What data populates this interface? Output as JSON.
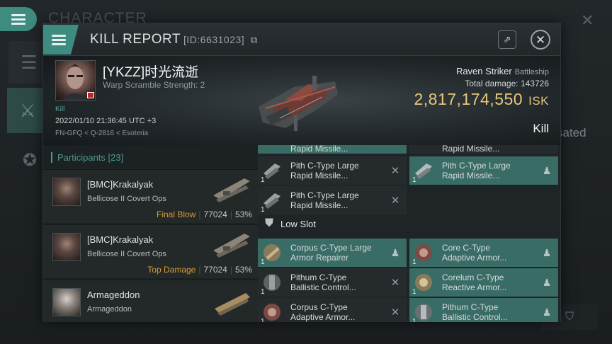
{
  "background_window": {
    "title": "CHARACTER",
    "side_text": "sated"
  },
  "header": {
    "title": "KILL REPORT",
    "id_label": "[ID:6631023]"
  },
  "victim": {
    "name": "[YKZZ]时光流逝",
    "warp_scramble": "Warp Scramble Strength: 2",
    "kill_tag": "Kill",
    "date": "2022/01/10 21:36:45 UTC +3",
    "location": "FN-GFQ < Q-2816 < Esoteria",
    "ship_name": "Raven Striker",
    "ship_class": "Battleship",
    "total_damage_label": "Total damage:",
    "total_damage": "143726",
    "isk_value": "2,817,174,550",
    "isk_unit": "ISK",
    "result": "Kill"
  },
  "participants": {
    "header": "Participants [23]",
    "items": [
      {
        "name": "[BMC]Krakalyak",
        "ship": "Bellicose II Covert Ops",
        "role": "Final Blow",
        "damage": "77024",
        "percent": "53%"
      },
      {
        "name": "[BMC]Krakalyak",
        "ship": "Bellicose II Covert Ops",
        "role": "Top Damage",
        "damage": "77024",
        "percent": "53%"
      },
      {
        "name": "Armageddon",
        "ship": "Armageddon",
        "role": "",
        "damage": "",
        "percent": ""
      }
    ]
  },
  "modules": {
    "top_partial": [
      {
        "name": "Rapid Missile...",
        "style": "hl"
      },
      {
        "name": "Rapid Missile...",
        "style": "dk"
      }
    ],
    "high_rows": [
      {
        "name1": "Pith C-Type Large",
        "name2": "Rapid Missile...",
        "qty": "1",
        "badge": "x",
        "style": "dk"
      },
      {
        "name1": "Pith C-Type Large",
        "name2": "Rapid Missile...",
        "qty": "1",
        "badge": "person",
        "style": "hl"
      },
      {
        "name1": "Pith C-Type Large",
        "name2": "Rapid Missile...",
        "qty": "1",
        "badge": "x",
        "style": "dk"
      }
    ],
    "low_slot_label": "Low Slot",
    "low_rows": [
      {
        "name1": "Corpus C-Type Large",
        "name2": "Armor Repairer",
        "qty": "1",
        "badge": "person",
        "style": "hl"
      },
      {
        "name1": "Core C-Type",
        "name2": "Adaptive Armor...",
        "qty": "1",
        "badge": "person",
        "style": "hl"
      },
      {
        "name1": "Pithum C-Type",
        "name2": "Ballistic Control...",
        "qty": "1",
        "badge": "x",
        "style": "dk"
      },
      {
        "name1": "Corelum C-Type",
        "name2": "Reactive Armor...",
        "qty": "1",
        "badge": "person",
        "style": "hl"
      },
      {
        "name1": "Corpus C-Type",
        "name2": "Adaptive Armor...",
        "qty": "1",
        "badge": "x",
        "style": "dk"
      },
      {
        "name1": "Pithum C-Type",
        "name2": "Ballistic Control...",
        "qty": "1",
        "badge": "person",
        "style": "hl"
      }
    ]
  },
  "colors": {
    "accent": "#3e8c80",
    "highlight_cell": "#3a6c66",
    "isk_gold": "#e7c77a",
    "role_orange": "#d89b3a"
  }
}
